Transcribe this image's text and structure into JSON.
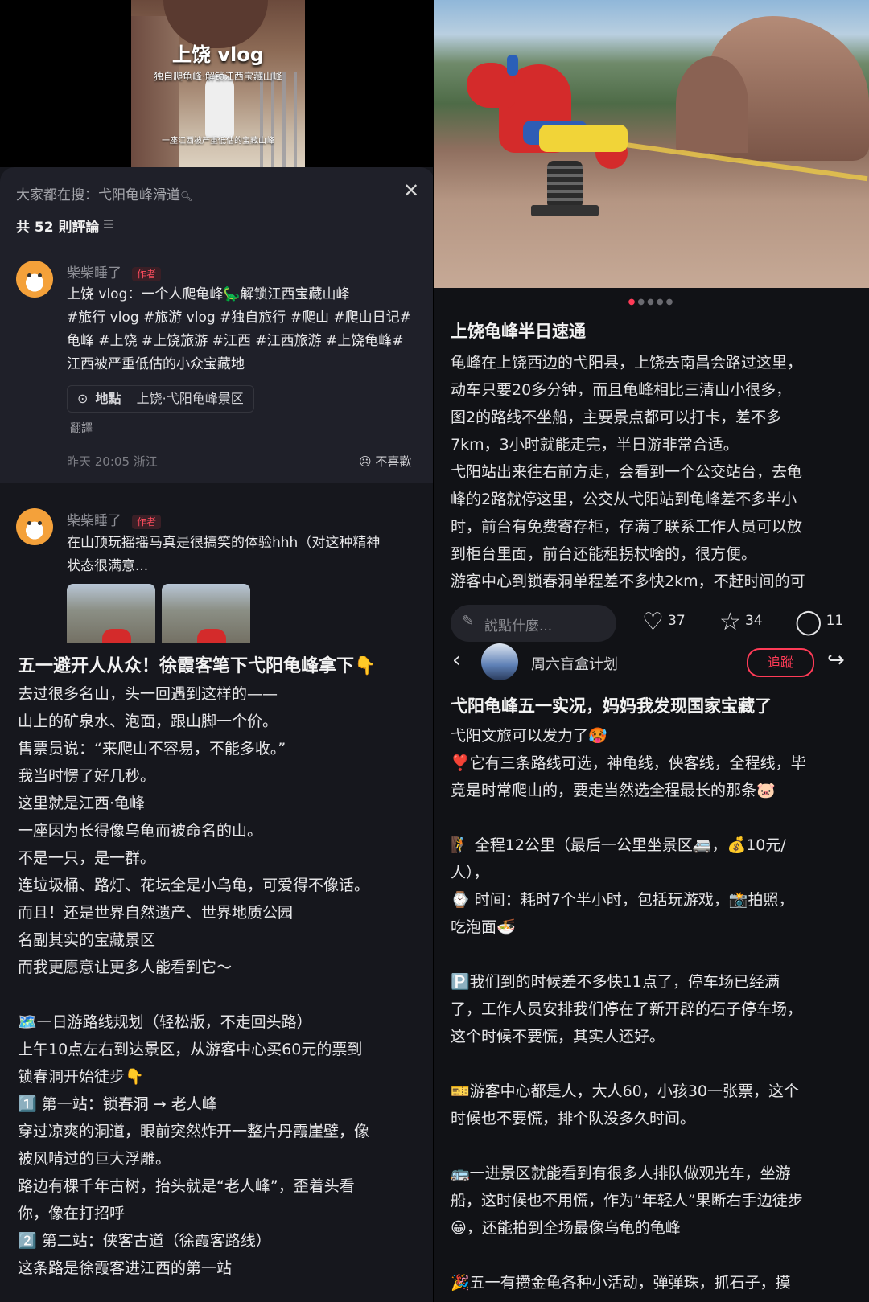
{
  "left": {
    "video": {
      "title": "上饶 vlog",
      "subtitle": "独自爬龟峰·解锁江西宝藏山峰",
      "caption": "一座江西被严重低估的宝藏山峰"
    },
    "comments_panel": {
      "search_hint": "大家都在搜：弋阳龟峰滑道",
      "count_label": "共 52 則評論",
      "comments": [
        {
          "user": "柴柴睡了",
          "badge": "作者",
          "lines": [
            "上饶 vlog：一个人爬龟峰🦕解锁江西宝藏山峰",
            "#旅行 vlog #旅游 vlog #独自旅行 #爬山 #爬山日记#",
            "龟峰 #上饶 #上饶旅游 #江西 #江西旅游 #上饶龟峰#",
            "江西被严重低估的小众宝藏地"
          ],
          "location_label": "地點",
          "location_value": "上饶·弋阳龟峰景区",
          "translate": "翻譯",
          "meta": "昨天 20:05 浙江",
          "dislike": "不喜歡"
        },
        {
          "user": "柴柴睡了",
          "badge": "作者",
          "lines": [
            "在山顶玩摇摇马真是很搞笑的体验hhh（对这种精神",
            "状态很满意..."
          ]
        }
      ]
    },
    "article": {
      "title": "五一避开人从众！徐霞客笔下弋阳龟峰拿下👇",
      "lines": [
        "去过很多名山，头一回遇到这样的——",
        "山上的矿泉水、泡面，跟山脚一个价。",
        "售票员说：“来爬山不容易，不能多收。”",
        "我当时愣了好几秒。",
        "这里就是江西·龟峰",
        "一座因为长得像乌龟而被命名的山。",
        "不是一只，是一群。",
        "连垃圾桶、路灯、花坛全是小乌龟，可爱得不像话。",
        "而且！还是世界自然遗产、世界地质公园",
        "名副其实的宝藏景区",
        "而我更愿意让更多人能看到它～",
        "",
        "🗺️一日游路线规划（轻松版，不走回头路）",
        "上午10点左右到达景区，从游客中心买60元的票到",
        "锁春洞开始徒步👇",
        "1️⃣ 第一站：锁春洞 → 老人峰",
        "穿过凉爽的洞道，眼前突然炸开一整片丹霞崖壁，像",
        "被风啃过的巨大浮雕。",
        "路边有棵千年古树，抬头就是“老人峰”，歪着头看",
        "你，像在打招呼",
        "2️⃣ 第二站：侠客古道（徐霞客路线）",
        "这条路是徐霞客进江西的第一站"
      ]
    }
  },
  "right": {
    "post1": {
      "title": "上饶龟峰半日速通",
      "lines": [
        "龟峰在上饶西边的弋阳县，上饶去南昌会路过这里，",
        "动车只要20多分钟，而且龟峰相比三清山小很多，",
        "图2的路线不坐船，主要景点都可以打卡，差不多",
        "7km，3小时就能走完，半日游非常合适。",
        "弋阳站出来往右前方走，会看到一个公交站台，去龟",
        "峰的2路就停这里，公交从弋阳站到龟峰差不多半小",
        "时，前台有免费寄存柜，存满了联系工作人员可以放",
        "到柜台里面，前台还能租拐杖啥的，很方便。",
        "游客中心到锁春洞单程差不多快2km，不赶时间的可"
      ],
      "comment_placeholder": "說點什麼...",
      "likes": "37",
      "stars": "34",
      "comments": "11"
    },
    "post2": {
      "username": "周六盲盒计划",
      "follow_label": "追蹤",
      "title": "弋阳龟峰五一实况，妈妈我发现国家宝藏了",
      "lines": [
        "弋阳文旅可以发力了🥵",
        "❣️它有三条路线可选，神龟线，侠客线，全程线，毕",
        "竟是时常爬山的，要走当然选全程最长的那条🐷",
        "",
        "🧗 全程12公里（最后一公里坐景区🚐，💰10元/",
        "人），",
        "⌚ 时间：耗时7个半小时，包括玩游戏，📸拍照，",
        "吃泡面🍜",
        "",
        "🅿️我们到的时候差不多快11点了，停车场已经满",
        "了，工作人员安排我们停在了新开辟的石子停车场，",
        "这个时候不要慌，其实人还好。",
        "",
        "🎫游客中心都是人，大人60，小孩30一张票，这个",
        "时候也不要慌，排个队没多久时间。",
        "",
        "🚌一进景区就能看到有很多人排队做观光车，坐游",
        "船，这时候也不用慌，作为“年轻人”果断右手边徒步",
        "😀，还能拍到全场最像乌龟的龟峰",
        "",
        "🎉五一有攒金龟各种小活动，弹弹珠，抓石子，摸"
      ]
    }
  }
}
